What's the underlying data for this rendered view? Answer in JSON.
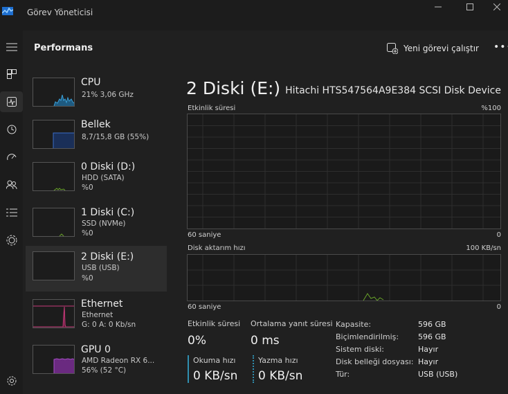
{
  "app": {
    "title": "Görev Yöneticisi"
  },
  "header": {
    "title": "Performans",
    "run_task": "Yeni görevi çalıştır",
    "more": "•••"
  },
  "nav": [
    "menu-icon",
    "processes-icon",
    "performance-icon",
    "app-history-icon",
    "startup-icon",
    "users-icon",
    "details-icon",
    "services-icon",
    "settings-icon"
  ],
  "devices": [
    {
      "name": "CPU",
      "line1": "21% 3,06 GHz",
      "line2": ""
    },
    {
      "name": "Bellek",
      "line1": "8,7/15,8 GB (55%)",
      "line2": ""
    },
    {
      "name": "0 Diski (D:)",
      "line1": "HDD (SATA)",
      "line2": "%0"
    },
    {
      "name": "1 Diski (C:)",
      "line1": "SSD (NVMe)",
      "line2": "%0"
    },
    {
      "name": "2 Diski (E:)",
      "line1": "USB (USB)",
      "line2": "%0"
    },
    {
      "name": "Ethernet",
      "line1": "Ethernet",
      "line2": "G: 0 A: 0 Kb/sn"
    },
    {
      "name": "GPU 0",
      "line1": "AMD Radeon RX 6...",
      "line2": "56% (52 °C)"
    }
  ],
  "detail": {
    "title": "2 Diski (E:)",
    "model": "Hitachi HTS547564A9E384 SCSI Disk Device",
    "graph1": {
      "label": "Etkinlik süresi",
      "max": "%100",
      "time": "60 saniye",
      "min": "0"
    },
    "graph2": {
      "label": "Disk aktarım hızı",
      "max": "100 KB/sn",
      "time": "60 saniye",
      "min": "0"
    },
    "stats": {
      "active_time_label": "Etkinlik süresi",
      "active_time": "0%",
      "response_label": "Ortalama yanıt süresi",
      "response": "0 ms",
      "read_label": "Okuma hızı",
      "read": "0 KB/sn",
      "write_label": "Yazma hızı",
      "write": "0 KB/sn"
    },
    "props": [
      {
        "label": "Kapasite:",
        "value": "596 GB"
      },
      {
        "label": "Biçimlendirilmiş:",
        "value": "596 GB"
      },
      {
        "label": "Sistem diski:",
        "value": "Hayır"
      },
      {
        "label": "Disk belleği dosyası:",
        "value": "Hayır"
      },
      {
        "label": "Tür:",
        "value": "USB (USB)"
      }
    ]
  },
  "colors": {
    "cpu": "#3aa0d8",
    "memory": "#3a6ec8",
    "disk": "#6aa52a",
    "ethernet": "#c83a7a",
    "gpu": "#a84fc8"
  }
}
